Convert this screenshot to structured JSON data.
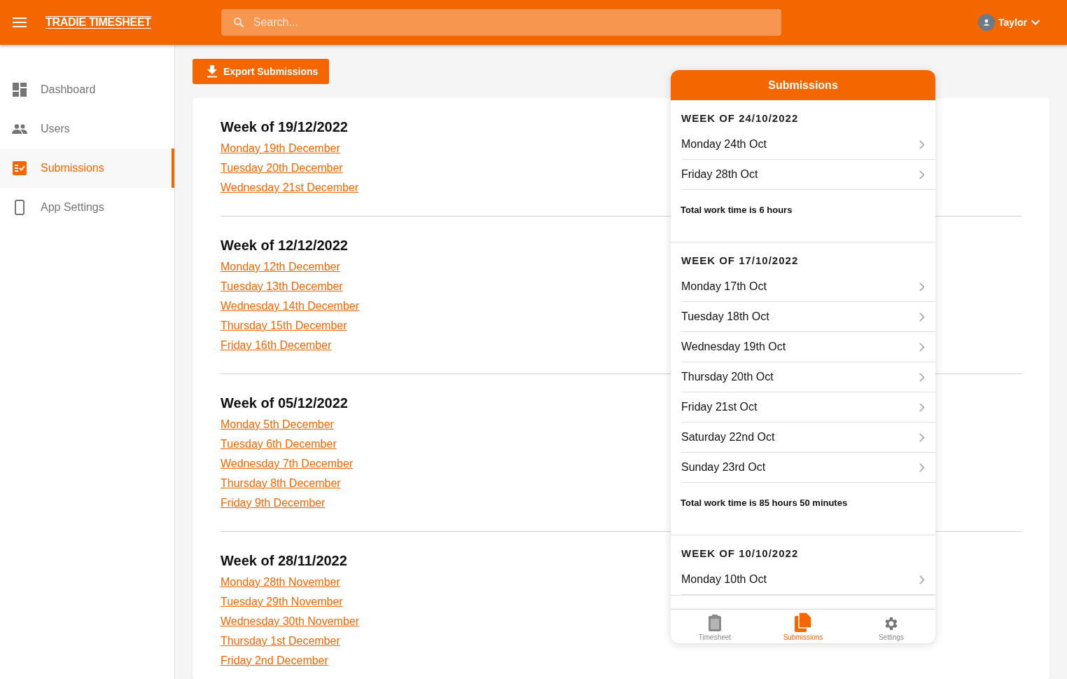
{
  "header": {
    "brand": "TRADIE TIMESHEET",
    "search": {
      "placeholder": "Search..."
    },
    "user": "Taylor"
  },
  "sidebar": {
    "items": [
      {
        "label": "Dashboard",
        "kind": "dashboard",
        "selected": false
      },
      {
        "label": "Users",
        "kind": "users",
        "selected": false
      },
      {
        "label": "Submissions",
        "kind": "submissions",
        "selected": true
      },
      {
        "label": "App Settings",
        "kind": "device",
        "selected": false
      }
    ]
  },
  "export_button": "Export Submissions",
  "weeks": [
    {
      "title": "Week of 19/12/2022",
      "days": [
        "Monday 19th December",
        "Tuesday 20th December",
        "Wednesday 21st December"
      ]
    },
    {
      "title": "Week of 12/12/2022",
      "days": [
        "Monday 12th December",
        "Tuesday 13th December",
        "Wednesday 14th December",
        "Thursday 15th December",
        "Friday 16th December"
      ]
    },
    {
      "title": "Week of 05/12/2022",
      "days": [
        "Monday 5th December",
        "Tuesday 6th December",
        "Wednesday 7th December",
        "Thursday 8th December",
        "Friday 9th December"
      ]
    },
    {
      "title": "Week of 28/11/2022",
      "days": [
        "Monday 28th November",
        "Tuesday 29th November",
        "Wednesday 30th November",
        "Thursday 1st December",
        "Friday 2nd December"
      ]
    }
  ],
  "phone": {
    "title": "Submissions",
    "weeks": [
      {
        "title": "WEEK OF 24/10/2022",
        "days": [
          "Monday 24th Oct",
          "Friday 28th Oct"
        ],
        "total": "Total work time is 6 hours"
      },
      {
        "title": "WEEK OF 17/10/2022",
        "days": [
          "Monday 17th Oct",
          "Tuesday 18th Oct",
          "Wednesday 19th Oct",
          "Thursday 20th Oct",
          "Friday 21st Oct",
          "Saturday 22nd Oct",
          "Sunday 23rd Oct"
        ],
        "total": "Total work time is 85 hours 50 minutes"
      },
      {
        "title": "WEEK OF 10/10/2022",
        "days": [
          "Monday 10th Oct"
        ]
      }
    ],
    "tabs": [
      {
        "label": "Timesheet",
        "kind": "clipboard",
        "selected": false
      },
      {
        "label": "Submissions",
        "kind": "files",
        "selected": true
      },
      {
        "label": "Settings",
        "kind": "gear",
        "selected": false
      }
    ]
  }
}
